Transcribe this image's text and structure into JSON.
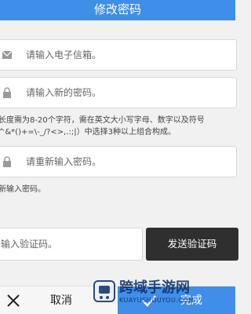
{
  "header": {
    "title": "修改密码"
  },
  "form": {
    "email": {
      "placeholder": "请输入电子信箱。"
    },
    "new_password": {
      "placeholder": "请输入新的密码。"
    },
    "rule_hint": {
      "line1": "长度需为8-20个字符，需在英文大小写字母、数字以及符号",
      "line2": "^&*()+=\\-_/?<>,.:;|）中选择3种以上组合构成。"
    },
    "confirm_password": {
      "placeholder": "请重新输入密码。"
    },
    "confirm_hint": "新输入密码。",
    "verification": {
      "placeholder": "输入验证码。",
      "send_button": "发送验证码"
    }
  },
  "bottom_bar": {
    "cancel_label": "取消",
    "confirm_label": "完成"
  },
  "watermark": {
    "main": "跨域手游网",
    "sub": "KUAYUSHOUYOU.COM"
  },
  "colors": {
    "accent": "#3f8ee8",
    "button_dark": "#2f2f2f"
  }
}
